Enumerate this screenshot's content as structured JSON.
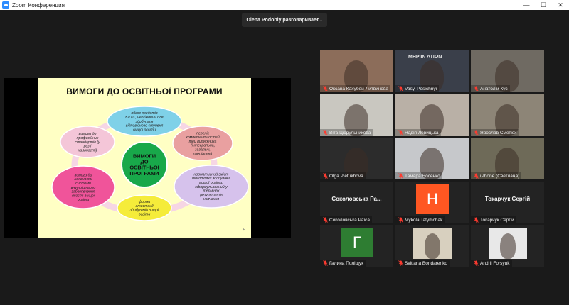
{
  "window": {
    "title": "Zoom Конференция"
  },
  "speaking": {
    "text": "Olena Podobiy разговаривает..."
  },
  "slide": {
    "title": "ВИМОГИ ДО ОСВІТНЬОЇ ПРОГРАМИ",
    "center": [
      "ВИМОГИ",
      "ДО",
      "ОСВІТНЬОЇ",
      "ПРОГРАМИ"
    ],
    "nodes": [
      {
        "lines": [
          "обсяг кредитів",
          "ЄКТС, необхідний для",
          "здобуття",
          "відповідного ступеня",
          "вищої освіти"
        ],
        "color": "#7fd1e8"
      },
      {
        "lines": [
          "перелік",
          "компетентностей",
          "тей випускника",
          "(інтегральна,",
          "загальні,",
          "спеціальні)"
        ],
        "color": "#e9a0a0"
      },
      {
        "lines": [
          "нормативний зміст",
          "підготовки здобувачів",
          "вищої освіти,",
          "сформульований у",
          "термінах",
          "результатів",
          "навчання"
        ],
        "color": "#d6c2ec"
      },
      {
        "lines": [
          "форми",
          "атестації",
          "здобувачів вищої",
          "освіти"
        ],
        "color": "#f5ec3a"
      },
      {
        "lines": [
          "вимоги до",
          "наявності",
          "системи",
          "внутрішнього",
          "забезпечення",
          "якості вищої",
          "освіти"
        ],
        "color": "#f0549a"
      },
      {
        "lines": [
          "вимоги до",
          "професійних",
          "стандартів (у",
          "раз і",
          "наявності)"
        ],
        "color": "#f4c6d8"
      }
    ],
    "page": "5"
  },
  "participants": [
    {
      "name": "Оксана Кахубей-Литвинова",
      "muted": true,
      "kind": "video",
      "bg": "#8c6d5a"
    },
    {
      "name": "Vasyl Posichnyi",
      "muted": true,
      "kind": "video",
      "bg": "#3a3f4a",
      "banner": "MHP IN    ATION"
    },
    {
      "name": "Анатолій Кус",
      "muted": true,
      "kind": "video",
      "bg": "#6f6a62"
    },
    {
      "name": "Віта Цюрульникова",
      "muted": true,
      "kind": "video",
      "bg": "#c9c7c0"
    },
    {
      "name": "Надія Левицька",
      "muted": true,
      "kind": "video",
      "bg": "#b9b0a6"
    },
    {
      "name": "Ярослав Сметюх",
      "muted": true,
      "kind": "video",
      "bg": "#8d8577"
    },
    {
      "name": "Olga Pietukhova",
      "muted": true,
      "kind": "video",
      "bg": "#2c2c2c"
    },
    {
      "name": "Тамара Носенко",
      "muted": true,
      "kind": "video",
      "bg": "#c6c8cb"
    },
    {
      "name": "iPhone (Светлана)",
      "muted": true,
      "kind": "video",
      "bg": "#6e6a58"
    },
    {
      "name": "Соколовська Раїса",
      "label": "Соколовська Ра...",
      "muted": true,
      "kind": "name"
    },
    {
      "name": "Mykola Tatymchak",
      "muted": true,
      "kind": "avatar",
      "letter": "Н",
      "color": "#ff5722"
    },
    {
      "name": "Токарчук Сергій",
      "label": "Токарчук Сергій",
      "muted": true,
      "kind": "name"
    },
    {
      "name": "Галина Поліщук",
      "muted": true,
      "kind": "avatar",
      "letter": "Г",
      "color": "#2e7d32"
    },
    {
      "name": "Svitlana Bondarenko",
      "muted": true,
      "kind": "photo",
      "bg": "#d8d0bf"
    },
    {
      "name": "Andrii Forsyuk",
      "muted": true,
      "kind": "photo",
      "bg": "#e8e8e8"
    }
  ],
  "icons": {
    "mic_muted": "mic-muted-icon",
    "app": "zoom-icon"
  },
  "colors": {
    "mic_muted": "#ff3b30",
    "accent": "#2d8cff"
  }
}
